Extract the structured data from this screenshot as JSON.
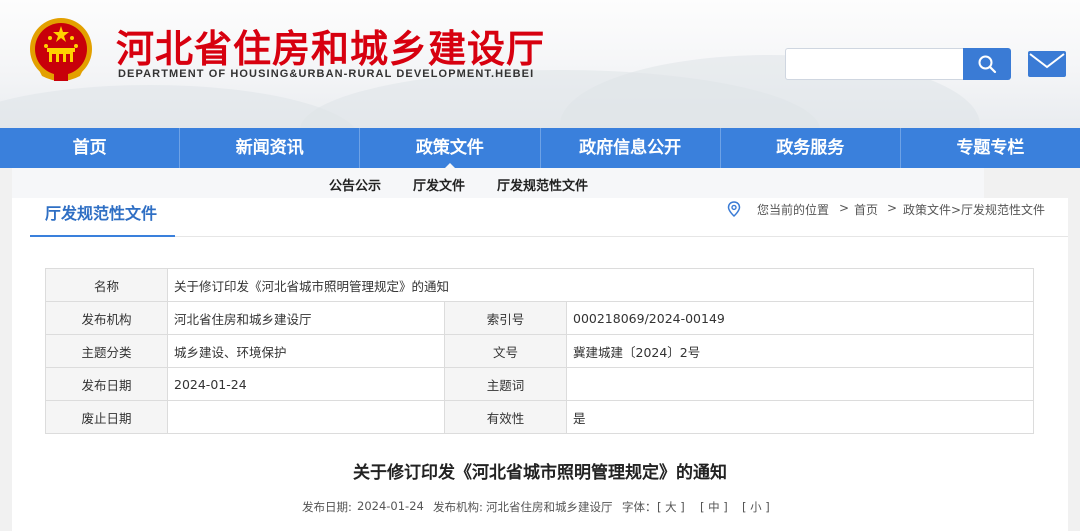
{
  "header": {
    "title": "河北省住房和城乡建设厅",
    "subtitle": "DEPARTMENT OF HOUSING&URBAN-RURAL DEVELOPMENT.HEBEI",
    "search_placeholder": "",
    "emblem_icon": "national-emblem",
    "search_icon": "search-icon",
    "mail_icon": "mail-icon"
  },
  "nav": {
    "items": [
      "首页",
      "新闻资讯",
      "政策文件",
      "政府信息公开",
      "政务服务",
      "专题专栏"
    ],
    "active": "政策文件"
  },
  "subnav": {
    "items": [
      "公告公示",
      "厅发文件",
      "厅发规范性文件"
    ]
  },
  "section": {
    "tab_label": "厅发规范性文件",
    "breadcrumb": {
      "prefix": "您当前的位置",
      "sep": ">",
      "home": "首页",
      "path": "政策文件>厅发规范性文件"
    }
  },
  "info_table": {
    "name_label": "名称",
    "name_value": "关于修订印发《河北省城市照明管理规定》的通知",
    "rows": [
      {
        "k1": "发布机构",
        "v1": "河北省住房和城乡建设厅",
        "k2": "索引号",
        "v2": "000218069/2024-00149"
      },
      {
        "k1": "主题分类",
        "v1": "城乡建设、环境保护",
        "k2": "文号",
        "v2": "冀建城建〔2024〕2号"
      },
      {
        "k1": "发布日期",
        "v1": "2024-01-24",
        "k2": "主题词",
        "v2": ""
      },
      {
        "k1": "废止日期",
        "v1": "",
        "k2": "有效性",
        "v2": "是"
      }
    ]
  },
  "article": {
    "title": "关于修订印发《河北省城市照明管理规定》的通知",
    "meta": {
      "date_label": "发布日期:",
      "date": "2024-01-24",
      "org_label": "发布机构:",
      "org": "河北省住房和城乡建设厅",
      "font_label": "字体：",
      "font_large": "[ 大 ]",
      "font_medium": "[ 中 ]",
      "font_small": "[ 小 ]"
    }
  },
  "colors": {
    "brand_red": "#d7000f",
    "nav_blue": "#3a80dc",
    "accent_blue": "#2f6fc4"
  }
}
